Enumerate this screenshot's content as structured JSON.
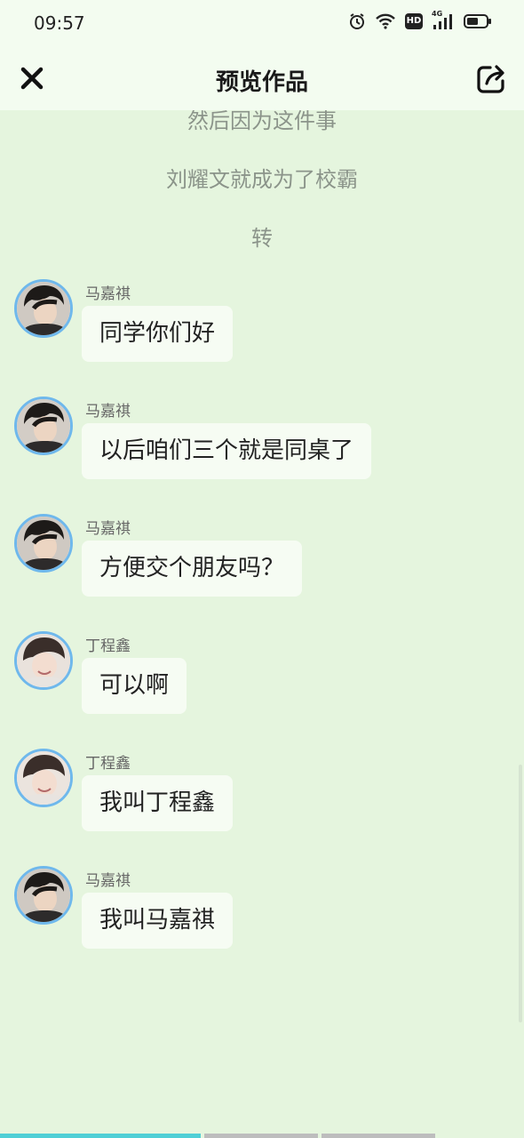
{
  "status": {
    "time": "09:57",
    "icons": [
      "alarm-icon",
      "wifi-icon",
      "hd-icon",
      "4g-signal-icon",
      "battery-icon"
    ],
    "network_label": "4G",
    "hd_label": "HD"
  },
  "header": {
    "title": "预览作品",
    "close_icon": "close-icon",
    "share_icon": "share-icon"
  },
  "narration": [
    "然后因为这件事",
    "刘耀文就成为了校霸",
    "转"
  ],
  "messages": [
    {
      "sender": "马嘉祺",
      "text": "同学你们好"
    },
    {
      "sender": "马嘉祺",
      "text": "以后咱们三个就是同桌了"
    },
    {
      "sender": "马嘉祺",
      "text": "方便交个朋友吗？"
    },
    {
      "sender": "丁程鑫",
      "text": "可以啊"
    },
    {
      "sender": "丁程鑫",
      "text": "我叫丁程鑫"
    },
    {
      "sender": "马嘉祺",
      "text": "我叫马嘉祺"
    }
  ],
  "colors": {
    "background": "#e5f5de",
    "bubble": "#f6fcf3",
    "avatar_ring": "#6fb8ec",
    "progress_active": "#4fcfd6",
    "progress_inactive": "#bdbdbd"
  },
  "progress": {
    "segments": 4,
    "active_fraction_of_first": 0.85
  }
}
